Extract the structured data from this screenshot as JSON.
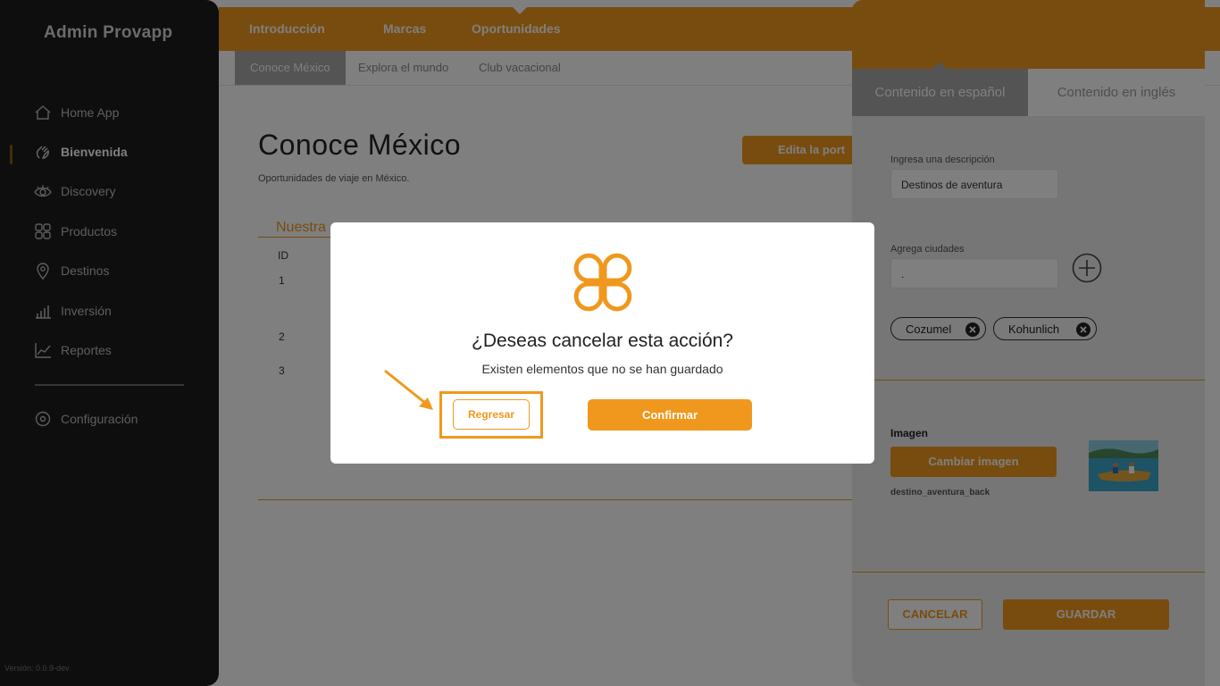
{
  "sidebar": {
    "brand": "Admin Provapp",
    "items": [
      {
        "label": "Home App",
        "icon": "home-icon"
      },
      {
        "label": "Bienvenida",
        "icon": "hand-wave-icon",
        "active": true
      },
      {
        "label": "Discovery",
        "icon": "eye-icon"
      },
      {
        "label": "Productos",
        "icon": "products-icon"
      },
      {
        "label": "Destinos",
        "icon": "location-pin-icon"
      },
      {
        "label": "Inversión",
        "icon": "bar-chart-icon"
      },
      {
        "label": "Reportes",
        "icon": "line-chart-icon"
      }
    ],
    "settings": {
      "label": "Configuración",
      "icon": "gear-icon"
    },
    "version": "Versión: 0.0.9-dev"
  },
  "topnav": [
    "Introducción",
    "Marcas",
    "Oportunidades"
  ],
  "subtabs": [
    "Conoce México",
    "Explora el mundo",
    "Club vacacional"
  ],
  "page": {
    "title": "Conoce México",
    "subtitle": "Oportunidades de viaje en México.",
    "edit_button": "Edita la port",
    "section_title": "Nuestra",
    "table": {
      "header_id": "ID",
      "rows": [
        "1",
        "2",
        "3"
      ]
    }
  },
  "panel": {
    "tab_es": "Contenido en español",
    "tab_en": "Contenido en inglés",
    "desc_label": "Ingresa una descripción",
    "desc_value": "Destinos de aventura",
    "cities_label": "Agrega ciudades",
    "cities_value": ".",
    "chips": [
      "Cozumel",
      "Kohunlich"
    ],
    "image_label": "Imagen",
    "change_image": "Cambiar imagen",
    "filename": "destino_aventura_back",
    "cancel": "CANCELAR",
    "save": "GUARDAR"
  },
  "modal": {
    "title": "¿Deseas cancelar esta acción?",
    "subtitle": "Existen elementos que no se han guardado",
    "back_button": "Regresar",
    "confirm_button": "Confirmar"
  },
  "colors": {
    "accent": "#f0981d",
    "sidebar": "#1c1c1c",
    "tab_active": "#a9a9a9"
  }
}
